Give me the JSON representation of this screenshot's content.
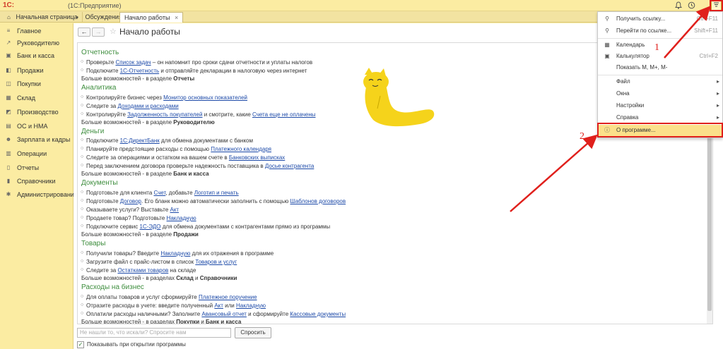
{
  "app": {
    "logo": "1С:",
    "title": "(1С:Предприятие)"
  },
  "tabs": [
    {
      "label": "Начальная страница",
      "icon": "home-icon"
    },
    {
      "label": "Обсуждения",
      "icon": "chat-icon"
    },
    {
      "label": "Начало работы",
      "close": "×"
    }
  ],
  "sidebar": {
    "items": [
      {
        "label": "Главное",
        "icon": "menu-icon"
      },
      {
        "label": "Руководителю",
        "icon": "chart-icon"
      },
      {
        "label": "Банк и касса",
        "icon": "bank-icon"
      },
      {
        "label": "Продажи",
        "icon": "bag-icon"
      },
      {
        "label": "Покупки",
        "icon": "cart-icon"
      },
      {
        "label": "Склад",
        "icon": "box-icon"
      },
      {
        "label": "Производство",
        "icon": "factory-icon"
      },
      {
        "label": "ОС и НМА",
        "icon": "building-icon"
      },
      {
        "label": "Зарплата и кадры",
        "icon": "people-icon"
      },
      {
        "label": "Операции",
        "icon": "dt-kt-icon"
      },
      {
        "label": "Отчеты",
        "icon": "report-icon"
      },
      {
        "label": "Справочники",
        "icon": "book-icon"
      },
      {
        "label": "Администрирование",
        "icon": "gear-icon"
      }
    ]
  },
  "page": {
    "title": "Начало работы",
    "back": "←",
    "forward": "→",
    "star": "☆"
  },
  "sections": {
    "reports": {
      "heading": "Отчетность",
      "l1": [
        "Проверьте ",
        "Список задач",
        " – он напомнит про сроки сдачи отчетности и уплаты налогов"
      ],
      "l2": [
        "Подключите ",
        "1С-Отчетность",
        " и отправляйте декларации в налоговую через интернет"
      ],
      "more": [
        "Больше возможностей - в разделе ",
        "Отчеты"
      ]
    },
    "analytics": {
      "heading": "Аналитика",
      "l1": [
        "Контролируйте бизнес через ",
        "Монитор основных показателей"
      ],
      "l2": [
        "Следите за ",
        "Доходами и расходами"
      ],
      "l3": [
        "Контролируйте ",
        "Задолженность покупателей",
        " и смотрите, какие ",
        "Счета еще не оплачены"
      ],
      "more": [
        "Больше возможностей - в разделе ",
        "Руководителю"
      ]
    },
    "money": {
      "heading": "Деньги",
      "l1": [
        "Подключите ",
        "1С:ДиректБанк",
        " для обмена документами с банком"
      ],
      "l2": [
        "Планируйте предстоящие расходы с помощью ",
        "Платежного календаря"
      ],
      "l3": [
        "Следите за операциями и остатком на вашем счете в ",
        "Банковских выписках"
      ],
      "l4": [
        "Перед заключением договора проверьте надежность поставщика в ",
        "Досье контрагента"
      ],
      "more": [
        "Больше возможностей - в разделе ",
        "Банк и касса"
      ]
    },
    "docs": {
      "heading": "Документы",
      "l1": [
        "Подготовьте для клиента ",
        "Счет",
        ", добавьте ",
        "Логотип и печать"
      ],
      "l2": [
        "Подготовьте ",
        "Договор",
        ". Его бланк можно автоматически заполнить с помощью ",
        "Шаблонов договоров"
      ],
      "l3": [
        "Оказываете услуги? Выставьте ",
        "Акт"
      ],
      "l4": [
        "Продаете товар? Подготовьте ",
        "Накладную"
      ],
      "l5": [
        "Подключите сервис ",
        "1С-ЭДО",
        " для обмена документами с контрагентами прямо из программы"
      ],
      "more": [
        "Больше возможностей - в разделе ",
        "Продажи"
      ]
    },
    "goods": {
      "heading": "Товары",
      "l1": [
        "Получили товары? Введите ",
        "Накладную",
        " для их отражения в программе"
      ],
      "l2": [
        "Загрузите файл с прайс-листом в список ",
        "Товаров и услуг"
      ],
      "l3": [
        "Следите за ",
        "Остатками товаров",
        " на складе"
      ],
      "more": [
        "Больше возможностей - в разделах ",
        "Склад",
        " и ",
        "Справочники"
      ]
    },
    "expenses": {
      "heading": "Расходы на бизнес",
      "l1": [
        "Для оплаты товаров и услуг сформируйте ",
        "Платежное поручение"
      ],
      "l2": [
        "Отразите расходы в учете: введите полученный ",
        "Акт",
        " или ",
        "Накладную"
      ],
      "l3": [
        "Оплатили расходы наличными? Заполните ",
        "Авансовый отчет",
        " и сформируйте ",
        "Кассовые документы"
      ],
      "more": [
        "Больше возможностей - в разделах ",
        "Покупки",
        " и ",
        "Банк и касса"
      ]
    }
  },
  "search": {
    "placeholder": "Не нашли то, что искали? Спросите нам",
    "button": "Спросить"
  },
  "show_on_start": {
    "checked": "✓",
    "label": "Показывать при открытии программы"
  },
  "menu": {
    "get_link": {
      "label": "Получить ссылку...",
      "shortcut": "Ctrl+F11"
    },
    "go_link": {
      "label": "Перейти по ссылке...",
      "shortcut": "Shift+F11"
    },
    "calendar": {
      "label": "Календарь"
    },
    "calculator": {
      "label": "Калькулятор",
      "shortcut": "Ctrl+F2"
    },
    "memory": {
      "label": "Показать М, М+, М-"
    },
    "file": {
      "label": "Файл"
    },
    "windows": {
      "label": "Окна"
    },
    "settings": {
      "label": "Настройки"
    },
    "help": {
      "label": "Справка"
    },
    "about": {
      "label": "О программе..."
    }
  },
  "annotations": {
    "one": "1",
    "two": "2"
  },
  "colors": {
    "accent_red": "#e0201c",
    "section_green": "#3d8d3d",
    "link_blue": "#1d4aa8",
    "panel_yellow": "#fbeca2"
  }
}
